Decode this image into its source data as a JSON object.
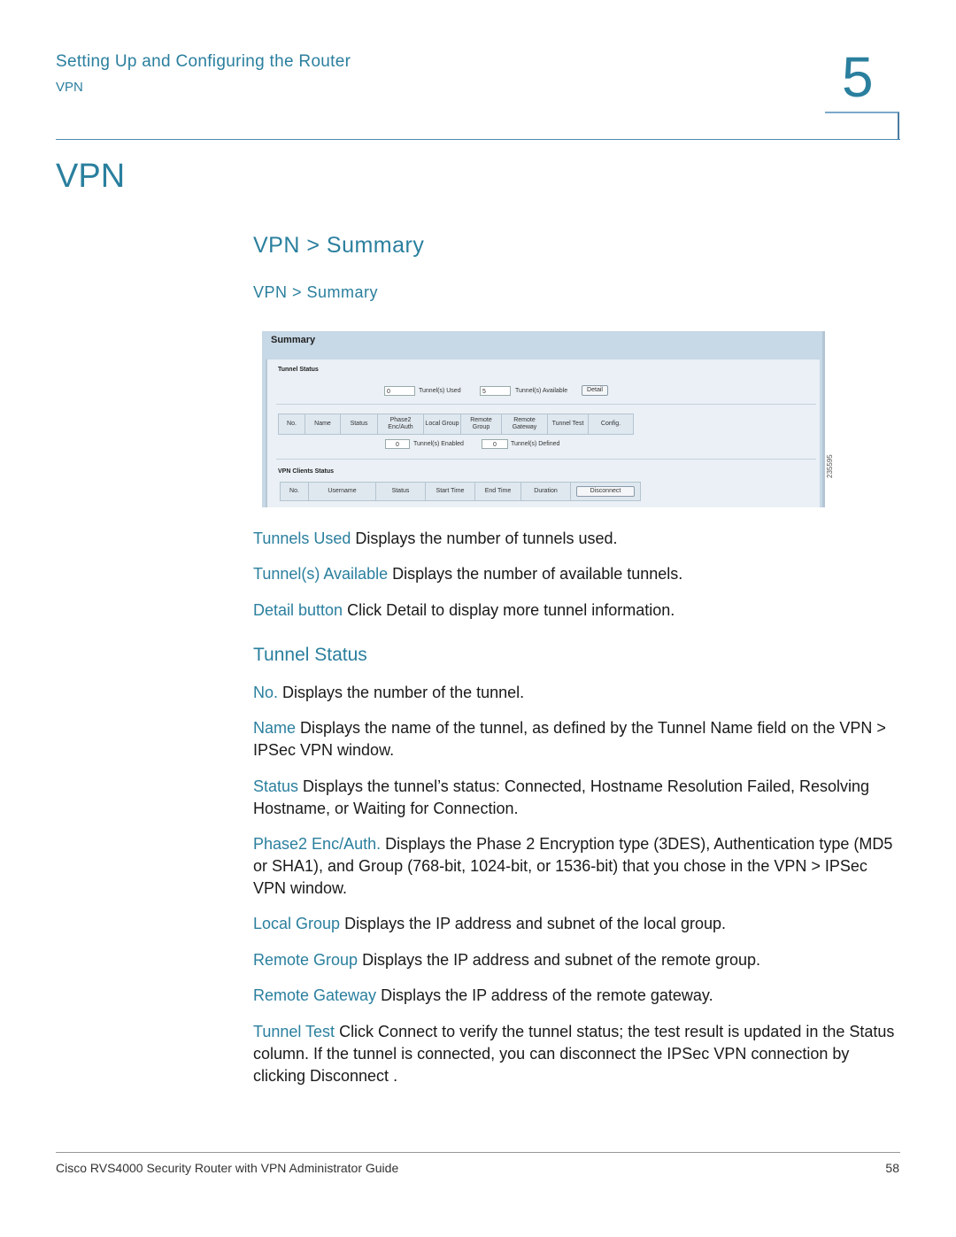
{
  "header": {
    "chapter_title": "Setting Up and Configuring the Router",
    "section": "VPN",
    "chapter_number": "5"
  },
  "heading1": "VPN",
  "heading2": "VPN > Summary",
  "figure_caption": "VPN > Summary",
  "figure": {
    "page_title": "Summary",
    "tunnel_status_label": "Tunnel Status",
    "tunnels_used_value": "0",
    "tunnels_used_label": "Tunnel(s) Used",
    "tunnels_available_value": "5",
    "tunnels_available_label": "Tunnel(s) Available",
    "detail_button": "Detail",
    "tunnel_columns": [
      "No.",
      "Name",
      "Status",
      "Phase2 Enc/Auth",
      "Local Group",
      "Remote Group",
      "Remote Gateway",
      "Tunnel Test",
      "Config."
    ],
    "tunnels_enabled_value": "0",
    "tunnels_enabled_label": "Tunnel(s) Enabled",
    "tunnels_defined_value": "0",
    "tunnels_defined_label": "Tunnel(s) Defined",
    "clients_status_label": "VPN Clients Status",
    "client_columns": [
      "No.",
      "Username",
      "Status",
      "Start Time",
      "End Time",
      "Duration"
    ],
    "disconnect_button": "Disconnect",
    "figure_id": "235595"
  },
  "definitions_top": [
    {
      "term": "Tunnels Used",
      "text": " Displays the number of tunnels used."
    },
    {
      "term": "Tunnel(s) Available",
      "text": " Displays the number of available tunnels."
    },
    {
      "term": "Detail button",
      "text": " Click Detail to display more tunnel information."
    }
  ],
  "heading3": "Tunnel Status",
  "definitions": [
    {
      "term": "No.",
      "text": " Displays the number of the tunnel."
    },
    {
      "term": "Name",
      "text": " Displays the name of the tunnel, as defined by the Tunnel Name field on the VPN > IPSec VPN window."
    },
    {
      "term": "Status",
      "text": " Displays the tunnel’s status: Connected, Hostname Resolution Failed, Resolving Hostname, or Waiting for Connection."
    },
    {
      "term": "Phase2 Enc/Auth.",
      "text": " Displays the Phase 2 Encryption type (3DES), Authentication type (MD5 or SHA1), and Group (768-bit, 1024-bit, or 1536-bit) that you chose in the VPN > IPSec VPN window."
    },
    {
      "term": "Local Group",
      "text": " Displays the IP address and subnet of the local group."
    },
    {
      "term": "Remote Group",
      "text": " Displays the IP address and subnet of the remote group."
    },
    {
      "term": "Remote Gateway",
      "text": " Displays the IP address of the remote gateway."
    },
    {
      "term": "Tunnel Test",
      "text": " Click Connect to verify the tunnel status; the test result is updated in the Status column. If the tunnel is connected, you can disconnect the IPSec VPN connection by clicking Disconnect ."
    }
  ],
  "footer": {
    "guide_title": "Cisco RVS4000 Security Router with VPN Administrator Guide",
    "page_number": "58"
  }
}
